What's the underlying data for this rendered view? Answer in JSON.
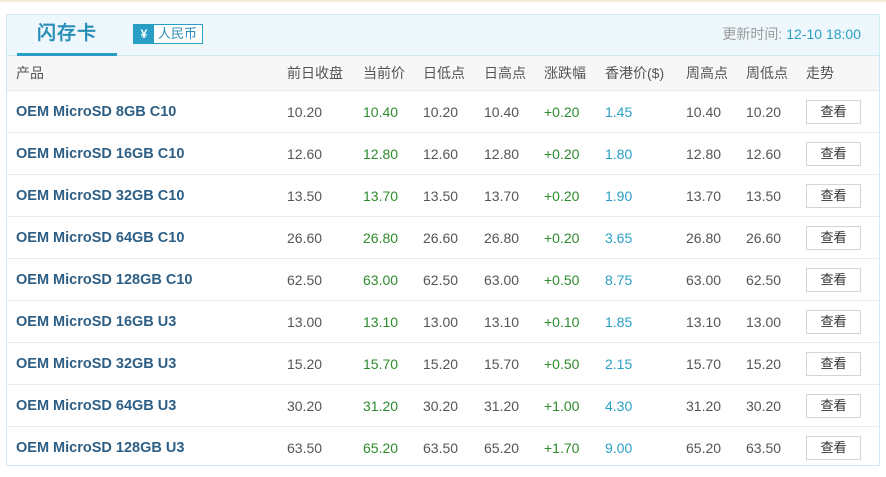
{
  "header": {
    "tab_title": "闪存卡",
    "currency_symbol": "¥",
    "currency_label": "人民币",
    "update_label": "更新时间:",
    "update_time": "12-10 18:00"
  },
  "columns": [
    "产品",
    "前日收盘",
    "当前价",
    "日低点",
    "日高点",
    "涨跌幅",
    "香港价($)",
    "周高点",
    "周低点",
    "走势"
  ],
  "rows": [
    {
      "product": "OEM MicroSD 8GB C10",
      "prev_close": "10.20",
      "current": "10.40",
      "day_low": "10.20",
      "day_high": "10.40",
      "change": "+0.20",
      "hk_price": "1.45",
      "week_high": "10.40",
      "week_low": "10.20",
      "trend": "查看"
    },
    {
      "product": "OEM MicroSD 16GB C10",
      "prev_close": "12.60",
      "current": "12.80",
      "day_low": "12.60",
      "day_high": "12.80",
      "change": "+0.20",
      "hk_price": "1.80",
      "week_high": "12.80",
      "week_low": "12.60",
      "trend": "查看"
    },
    {
      "product": "OEM MicroSD 32GB C10",
      "prev_close": "13.50",
      "current": "13.70",
      "day_low": "13.50",
      "day_high": "13.70",
      "change": "+0.20",
      "hk_price": "1.90",
      "week_high": "13.70",
      "week_low": "13.50",
      "trend": "查看"
    },
    {
      "product": "OEM MicroSD 64GB C10",
      "prev_close": "26.60",
      "current": "26.80",
      "day_low": "26.60",
      "day_high": "26.80",
      "change": "+0.20",
      "hk_price": "3.65",
      "week_high": "26.80",
      "week_low": "26.60",
      "trend": "查看"
    },
    {
      "product": "OEM MicroSD 128GB C10",
      "prev_close": "62.50",
      "current": "63.00",
      "day_low": "62.50",
      "day_high": "63.00",
      "change": "+0.50",
      "hk_price": "8.75",
      "week_high": "63.00",
      "week_low": "62.50",
      "trend": "查看"
    },
    {
      "product": "OEM MicroSD 16GB U3",
      "prev_close": "13.00",
      "current": "13.10",
      "day_low": "13.00",
      "day_high": "13.10",
      "change": "+0.10",
      "hk_price": "1.85",
      "week_high": "13.10",
      "week_low": "13.00",
      "trend": "查看"
    },
    {
      "product": "OEM MicroSD 32GB U3",
      "prev_close": "15.20",
      "current": "15.70",
      "day_low": "15.20",
      "day_high": "15.70",
      "change": "+0.50",
      "hk_price": "2.15",
      "week_high": "15.70",
      "week_low": "15.20",
      "trend": "查看"
    },
    {
      "product": "OEM MicroSD 64GB U3",
      "prev_close": "30.20",
      "current": "31.20",
      "day_low": "30.20",
      "day_high": "31.20",
      "change": "+1.00",
      "hk_price": "4.30",
      "week_high": "31.20",
      "week_low": "30.20",
      "trend": "查看"
    },
    {
      "product": "OEM MicroSD 128GB U3",
      "prev_close": "63.50",
      "current": "65.20",
      "day_low": "63.50",
      "day_high": "65.20",
      "change": "+1.70",
      "hk_price": "9.00",
      "week_high": "65.20",
      "week_low": "63.50",
      "trend": "查看"
    }
  ],
  "colors": {
    "accent": "#2a9fc6",
    "product_name": "#2d5f86",
    "up_green": "#2e8b2e",
    "header_bg": "#eef7fb"
  }
}
